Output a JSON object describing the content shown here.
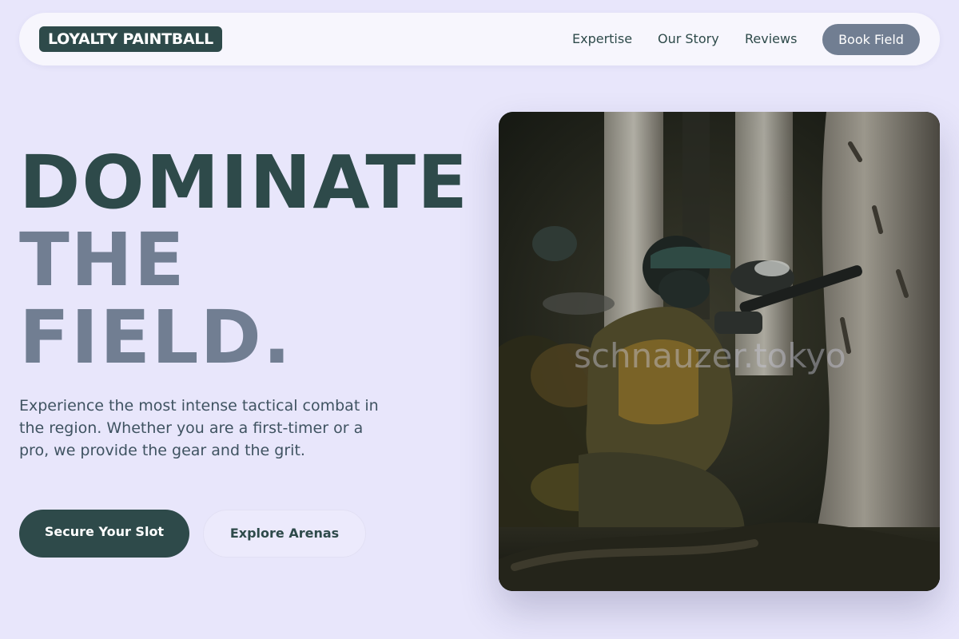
{
  "nav": {
    "brand": "LOYALTY PAINTBALL",
    "links": [
      "Expertise",
      "Our Story",
      "Reviews"
    ],
    "cta": "Book Field"
  },
  "hero": {
    "headline": [
      "DOMINATE",
      "THE",
      "FIELD."
    ],
    "lede": "Experience the most intense tactical combat in the region. Whether you are a first-timer or a pro, we provide the gear and the grit.",
    "primary_cta": "Secure Your Slot",
    "secondary_cta": "Explore Arenas"
  },
  "image": {
    "subject": "paintball-player-in-forest-photo",
    "watermark": "schnauzer.tokyo"
  },
  "colors": {
    "background": "#e8e6fb",
    "brand_dark": "#2e4a4a",
    "muted_slate": "#717e92",
    "nav_surface": "#f7f6fd"
  }
}
